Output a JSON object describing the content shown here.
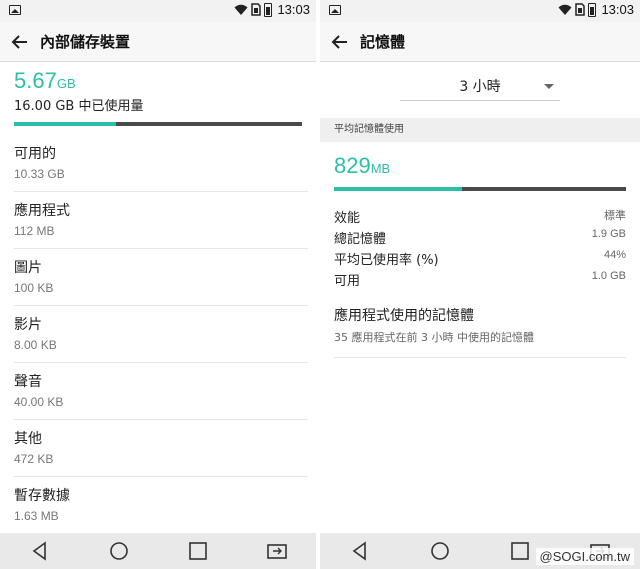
{
  "status": {
    "time": "13:03"
  },
  "left": {
    "title": "內部儲存裝置",
    "used_value": "5.67",
    "used_unit": "GB",
    "total_text": "16.00 GB 中已使用量",
    "usage_fraction": 0.354,
    "items": [
      {
        "label": "可用的",
        "value": "10.33 GB"
      },
      {
        "label": "應用程式",
        "value": "112 MB"
      },
      {
        "label": "圖片",
        "value": "100 KB"
      },
      {
        "label": "影片",
        "value": "8.00 KB"
      },
      {
        "label": "聲音",
        "value": "40.00 KB"
      },
      {
        "label": "其他",
        "value": "472 KB"
      },
      {
        "label": "暫存數據",
        "value": "1.63 MB"
      }
    ]
  },
  "right": {
    "title": "記憶體",
    "dropdown_value": "3 小時",
    "section_header": "平均記憶體使用",
    "avg_value": "829",
    "avg_unit": "MB",
    "usage_fraction": 0.44,
    "stats": [
      {
        "label": "效能",
        "value": "標準"
      },
      {
        "label": "總記憶體",
        "value": "1.9 GB"
      },
      {
        "label": "平均已使用率 (%)",
        "value": "44%"
      },
      {
        "label": "可用",
        "value": "1.0 GB"
      }
    ],
    "apps_title": "應用程式使用的記憶體",
    "apps_subtitle": "35 應用程式在前 3 小時 中使用的記憶體"
  },
  "watermark": "@SOGI.com.tw",
  "colors": {
    "accent": "#2bbfa8",
    "bar_track": "#4a4a4a"
  }
}
